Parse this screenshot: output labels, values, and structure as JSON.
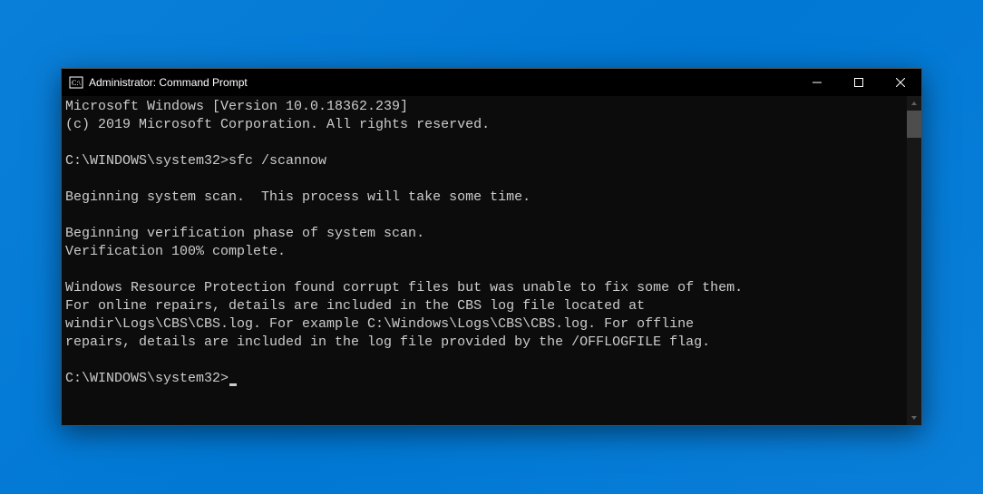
{
  "window": {
    "title": "Administrator: Command Prompt"
  },
  "terminal": {
    "lines": [
      "Microsoft Windows [Version 10.0.18362.239]",
      "(c) 2019 Microsoft Corporation. All rights reserved.",
      "",
      "C:\\WINDOWS\\system32>sfc /scannow",
      "",
      "Beginning system scan.  This process will take some time.",
      "",
      "Beginning verification phase of system scan.",
      "Verification 100% complete.",
      "",
      "Windows Resource Protection found corrupt files but was unable to fix some of them.",
      "For online repairs, details are included in the CBS log file located at",
      "windir\\Logs\\CBS\\CBS.log. For example C:\\Windows\\Logs\\CBS\\CBS.log. For offline",
      "repairs, details are included in the log file provided by the /OFFLOGFILE flag.",
      ""
    ],
    "prompt": "C:\\WINDOWS\\system32>"
  }
}
